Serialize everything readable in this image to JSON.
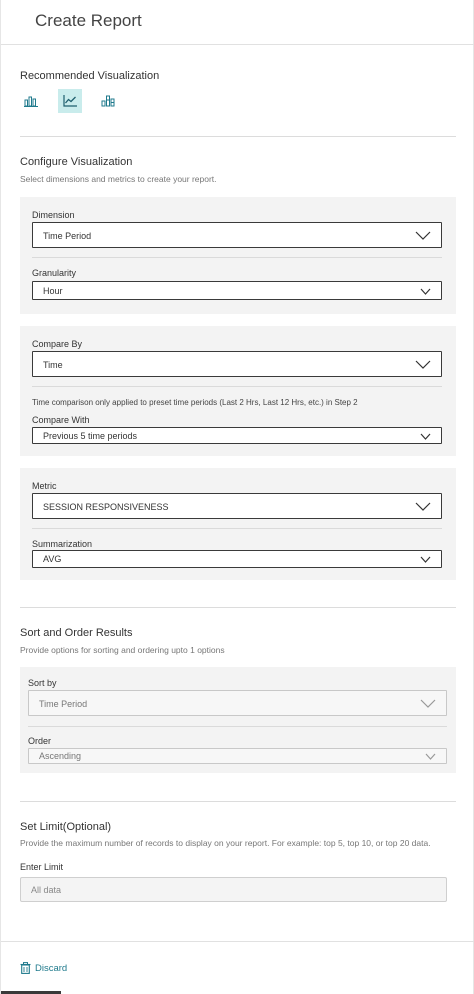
{
  "header": {
    "title": "Create Report"
  },
  "recommended": {
    "title": "Recommended Visualization",
    "icons": [
      "bar-chart-icon",
      "line-chart-icon",
      "stacked-bar-chart-icon"
    ],
    "active_index": 1,
    "accent": "#1f7a8c",
    "active_bg": "#c9ecec"
  },
  "configure": {
    "title": "Configure Visualization",
    "subtitle": "Select dimensions and metrics to create your report.",
    "dimension": {
      "label": "Dimension",
      "value": "Time Period"
    },
    "granularity": {
      "label": "Granularity",
      "value": "Hour"
    },
    "compare_by": {
      "label": "Compare By",
      "value": "Time"
    },
    "compare_note": "Time comparison only applied to preset time periods (Last 2 Hrs, Last 12 Hrs, etc.) in Step 2",
    "compare_with": {
      "label": "Compare With",
      "value": "Previous 5 time periods"
    },
    "metric": {
      "label": "Metric",
      "value": "SESSION RESPONSIVENESS"
    },
    "summarization": {
      "label": "Summarization",
      "value": "AVG"
    }
  },
  "sort": {
    "title": "Sort and Order Results",
    "subtitle": "Provide options for sorting and ordering upto 1 options",
    "sort_by": {
      "label": "Sort by",
      "value": "Time Period"
    },
    "order": {
      "label": "Order",
      "value": "Ascending"
    }
  },
  "limit": {
    "title": "Set Limit(Optional)",
    "subtitle": "Provide the maximum number of records to display on your report. For example: top 5, top 10, or top 20 data.",
    "label": "Enter Limit",
    "placeholder": "All data"
  },
  "footer": {
    "discard_label": "Discard"
  }
}
